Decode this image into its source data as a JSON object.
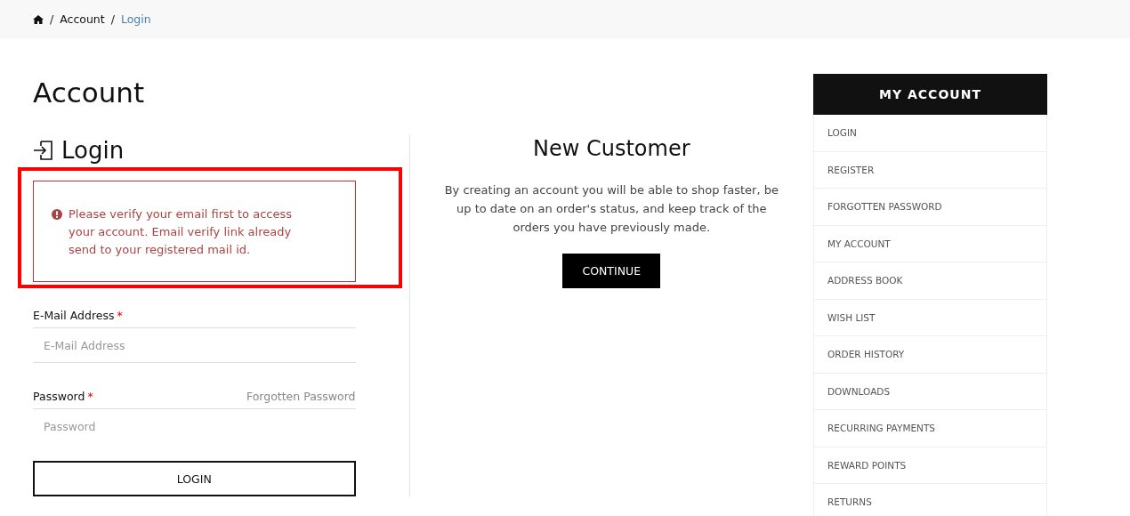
{
  "breadcrumb": [
    {
      "kind": "home"
    },
    {
      "kind": "separator",
      "label": "/"
    },
    {
      "kind": "link",
      "label": "Account",
      "current": false
    },
    {
      "kind": "separator",
      "label": "/"
    },
    {
      "kind": "link",
      "label": "Login",
      "current": true
    }
  ],
  "page_title": "Account",
  "login": {
    "title": "Login",
    "alert": {
      "text": "Please verify your email first to access your account. Email verify link already send to your registered mail id.",
      "highlighted": true
    },
    "fields": [
      {
        "label": "E-Mail Address",
        "required_mark": "*",
        "placeholder": "E-Mail Address"
      },
      {
        "label": "Password",
        "required_mark": "*",
        "placeholder": "Password",
        "link": "Forgotten Password"
      }
    ],
    "button": "LOGIN"
  },
  "new_customer": {
    "title": "New Customer",
    "text": "By creating an account you will be able to shop faster, be up to date on an order's status, and keep track of the orders you have previously made.",
    "button": "CONTINUE"
  },
  "sidebar": {
    "title": "MY ACCOUNT",
    "items": [
      "LOGIN",
      "REGISTER",
      "FORGOTTEN PASSWORD",
      "MY ACCOUNT",
      "ADDRESS BOOK",
      "WISH LIST",
      "ORDER HISTORY",
      "DOWNLOADS",
      "RECURRING PAYMENTS",
      "REWARD POINTS",
      "RETURNS"
    ]
  }
}
